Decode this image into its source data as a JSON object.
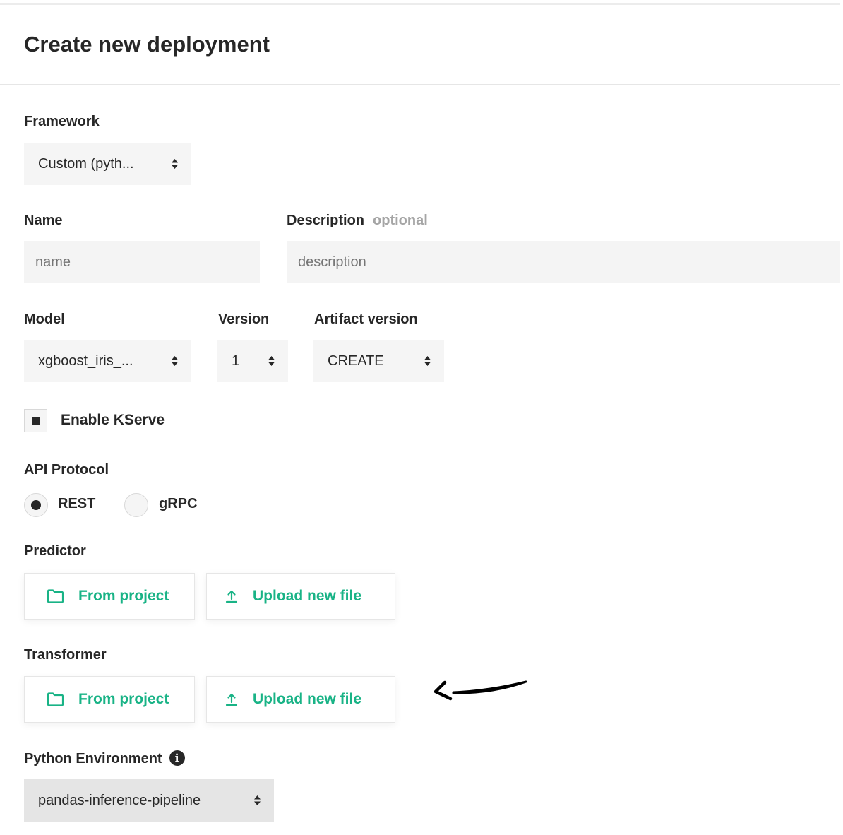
{
  "page": {
    "title": "Create new deployment"
  },
  "framework": {
    "label": "Framework",
    "value": "Custom (pyth..."
  },
  "name": {
    "label": "Name",
    "placeholder": "name",
    "value": ""
  },
  "description": {
    "label": "Description",
    "optional_label": "optional",
    "placeholder": "description",
    "value": ""
  },
  "model": {
    "label": "Model",
    "value": "xgboost_iris_..."
  },
  "version": {
    "label": "Version",
    "value": "1"
  },
  "artifact_version": {
    "label": "Artifact version",
    "value": "CREATE"
  },
  "kserve": {
    "label": "Enable KServe",
    "checked": true
  },
  "api_protocol": {
    "label": "API Protocol",
    "options": [
      {
        "label": "REST",
        "selected": true
      },
      {
        "label": "gRPC",
        "selected": false
      }
    ]
  },
  "predictor": {
    "label": "Predictor",
    "from_project_label": "From project",
    "upload_label": "Upload new file"
  },
  "transformer": {
    "label": "Transformer",
    "from_project_label": "From project",
    "upload_label": "Upload new file"
  },
  "python_environment": {
    "label": "Python Environment",
    "value": "pandas-inference-pipeline"
  },
  "colors": {
    "accent": "#19b386",
    "text": "#272727",
    "muted": "#a5a5a5",
    "field_bg": "#f5f5f5"
  },
  "icons": {
    "folder": "folder-icon",
    "upload": "upload-icon",
    "select_chevron": "sort-chevron-icon",
    "info": "info-icon",
    "annotation_arrow": "arrow-left-icon"
  }
}
